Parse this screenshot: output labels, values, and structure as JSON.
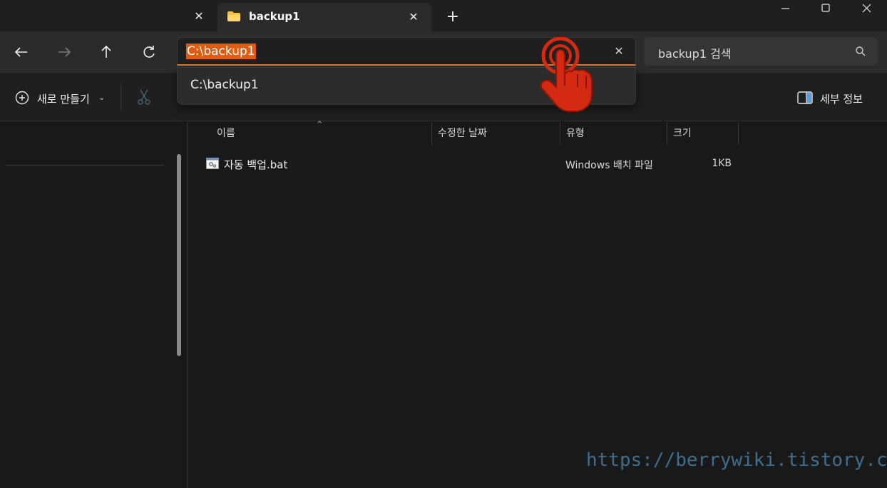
{
  "tabs": {
    "active_title": "backup1",
    "add_label": "+"
  },
  "nav": {
    "address_value": "C:\\backup1",
    "search_placeholder": "backup1 검색"
  },
  "suggestion": {
    "item": "C:\\backup1"
  },
  "commands": {
    "new_label": "새로 만들기",
    "details_label": "세부 정보"
  },
  "columns": {
    "name": "이름",
    "modified": "수정한 날짜",
    "type": "유형",
    "size": "크기"
  },
  "files": [
    {
      "name": "자동 백업.bat",
      "modified": "",
      "type": "Windows 배치 파일",
      "size": "1KB"
    }
  ],
  "watermark": "https://berrywiki.tistory.com",
  "colors": {
    "accent_highlight": "#e25c10",
    "address_underline": "#e07a30",
    "cursor_red": "#d42a12",
    "folder_yellow": "#f5c542",
    "watermark_blue": "#3f6e8e"
  },
  "icons": {
    "folder": "folder-icon",
    "back": "arrow-left-icon",
    "forward": "arrow-right-icon",
    "up": "arrow-up-icon",
    "refresh": "refresh-icon",
    "search": "search-icon",
    "new": "plus-circle-icon",
    "cut": "scissors-icon",
    "details": "details-pane-icon",
    "cursor": "hand-pointer-icon"
  }
}
